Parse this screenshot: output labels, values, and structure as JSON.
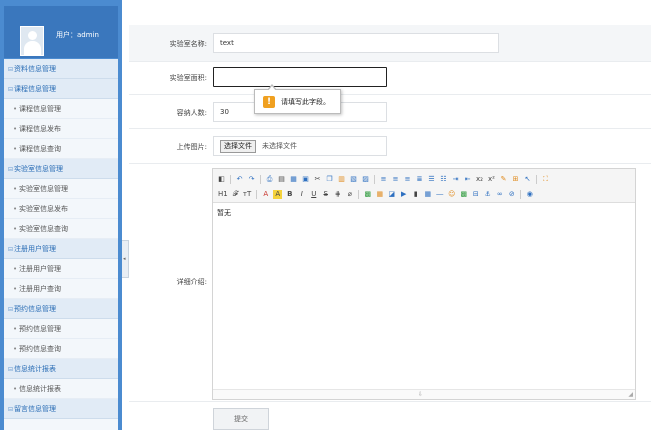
{
  "sidebar": {
    "user_label": "用户：admin",
    "menu": [
      {
        "title": "资料信息管理",
        "items": []
      },
      {
        "title": "课程信息管理",
        "items": [
          "课程信息管理",
          "课程信息发布",
          "课程信息查询"
        ]
      },
      {
        "title": "实验室信息管理",
        "items": [
          "实验室信息管理",
          "实验室信息发布",
          "实验室信息查询"
        ]
      },
      {
        "title": "注册用户管理",
        "items": [
          "注册用户管理",
          "注册用户查询"
        ]
      },
      {
        "title": "预约信息管理",
        "items": [
          "预约信息管理",
          "预约信息查询"
        ]
      },
      {
        "title": "信息统计报表",
        "items": [
          "信息统计报表"
        ]
      },
      {
        "title": "留言信息管理",
        "items": []
      }
    ]
  },
  "form": {
    "name_label": "实验室名称:",
    "name_value": "text",
    "area_label": "实验室面积:",
    "area_value": "",
    "capacity_label": "容纳人数:",
    "capacity_value": "30",
    "image_label": "上传图片:",
    "file_button": "选择文件",
    "file_status": "未选择文件",
    "desc_label": "详细介绍:",
    "desc_content": "暂无",
    "submit_label": "提交"
  },
  "tooltip": {
    "icon": "!",
    "text": "请填写此字段。"
  },
  "toolbar": {
    "heading": "H1",
    "font": "𝓕",
    "size": "тT",
    "font_color": "A",
    "bg_color": "A"
  }
}
